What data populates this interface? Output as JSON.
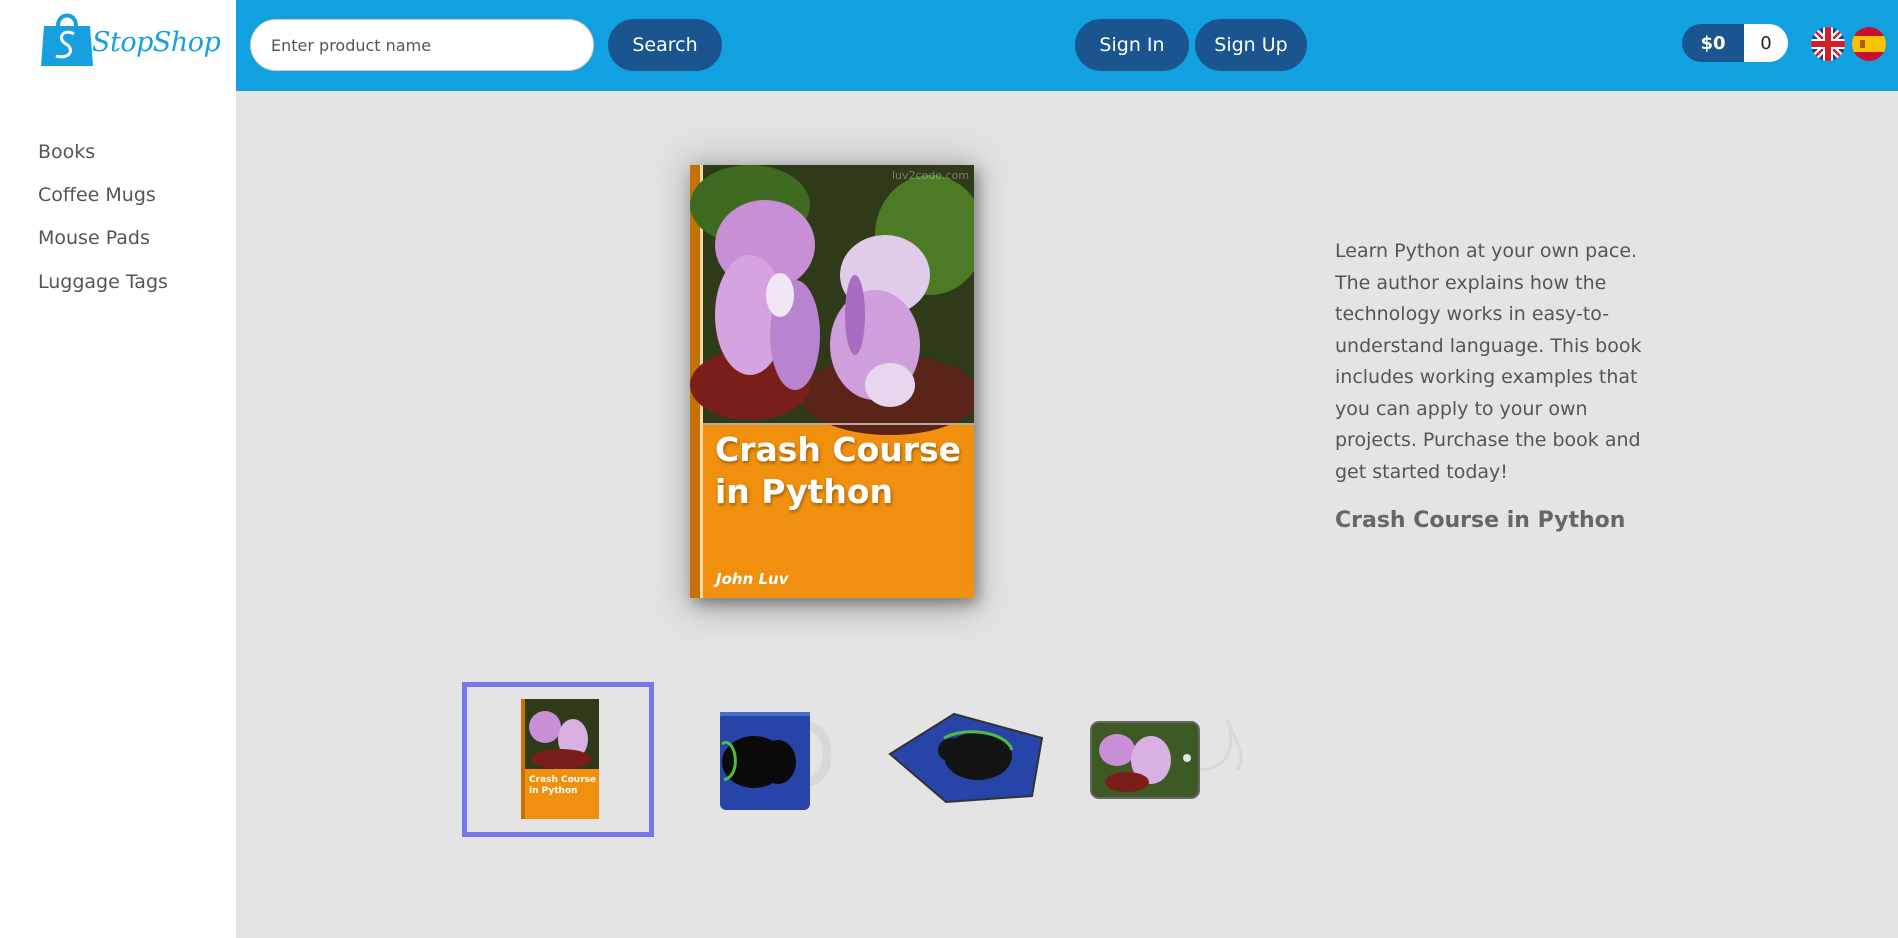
{
  "brand": {
    "logo_text": "StopShop"
  },
  "search": {
    "placeholder": "Enter product name",
    "value": "",
    "button_label": "Search"
  },
  "auth": {
    "signin_label": "Sign In",
    "signup_label": "Sign Up"
  },
  "cart": {
    "total": "$0",
    "count": "0"
  },
  "languages": [
    {
      "name": "English",
      "icon": "uk-flag-icon"
    },
    {
      "name": "Spanish",
      "icon": "spain-flag-icon"
    }
  ],
  "sidebar": {
    "items": [
      {
        "label": "Books"
      },
      {
        "label": "Coffee Mugs"
      },
      {
        "label": "Mouse Pads"
      },
      {
        "label": "Luggage Tags"
      }
    ]
  },
  "product": {
    "cover_title": "Crash Course in Python",
    "cover_author": "John Luv",
    "cover_watermark": "luv2code.com",
    "description": "Learn Python at your own pace. The author explains how the technology works in easy-to-understand language. This book includes working examples that you can apply to your own projects. Purchase the book and get started today!",
    "name": "Crash Course in Python"
  },
  "thumbnails": [
    {
      "name": "book",
      "selected": true,
      "mini_title": "Crash Course in Python"
    },
    {
      "name": "coffee-mug",
      "selected": false
    },
    {
      "name": "mouse-pad",
      "selected": false
    },
    {
      "name": "luggage-tag",
      "selected": false
    }
  ],
  "colors": {
    "header_bg": "#11a1e0",
    "button_bg": "#1b5590",
    "book_orange": "#f0900e",
    "thumb_border": "#7777ee",
    "page_bg": "#e4e4e4"
  }
}
